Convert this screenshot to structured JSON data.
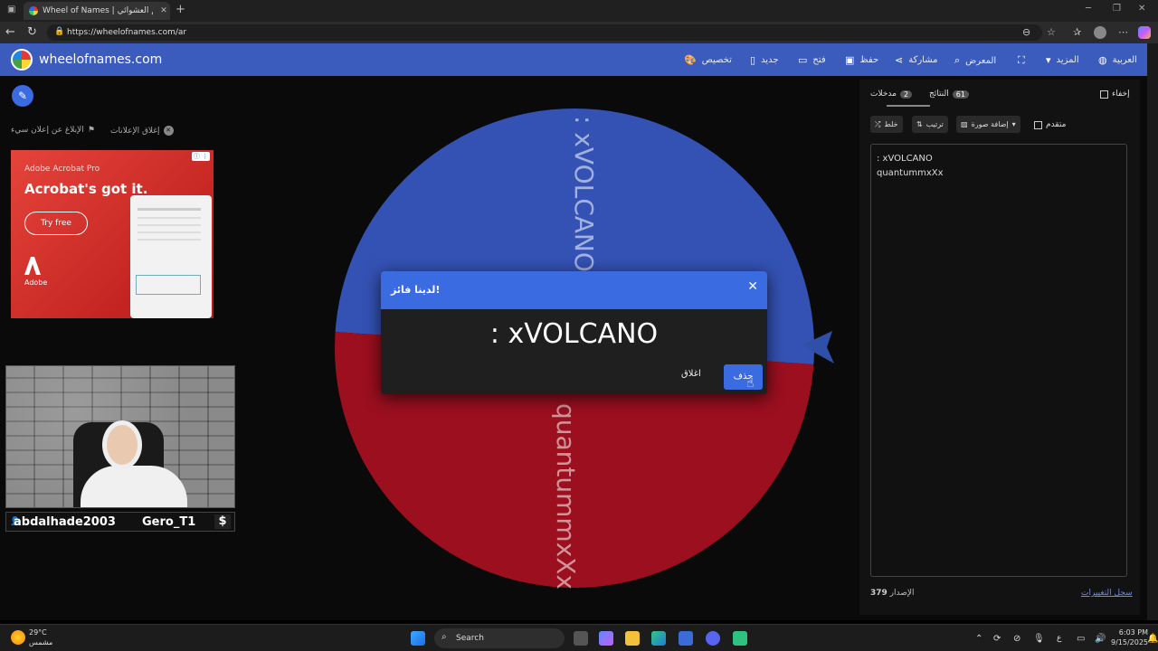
{
  "browser": {
    "tab_title": "Wheel of Names | الاسم العشوائي",
    "url": "https://wheelofnames.com/ar",
    "new_tab": "+",
    "tab_close": "✕"
  },
  "header": {
    "brand": "wheelofnames.com",
    "items": [
      {
        "label": "تخصيص",
        "icon": "palette-icon"
      },
      {
        "label": "جديد",
        "icon": "new-file-icon"
      },
      {
        "label": "فتح",
        "icon": "folder-icon"
      },
      {
        "label": "حفظ",
        "icon": "save-icon"
      },
      {
        "label": "مشاركة",
        "icon": "share-icon"
      },
      {
        "label": "المعرض",
        "icon": "search-icon"
      },
      {
        "label": "",
        "icon": "fullscreen-icon"
      },
      {
        "label": "المزيد",
        "icon": "caret-down-icon"
      },
      {
        "label": "العربية",
        "icon": "globe-icon"
      }
    ]
  },
  "ads": {
    "close_label": "إغلاق الإعلانات",
    "report_label": "الإبلاغ عن إعلان سيء",
    "brand": "Adobe Acrobat Pro",
    "headline": "Acrobat's got it.",
    "cta": "Try free",
    "logo_text": "Adobe"
  },
  "stream": {
    "name1": "abdalhade2003",
    "name2": "Gero_T1",
    "dollar": "$"
  },
  "wheel": {
    "segments": [
      {
        "label": ": xVOLCANO",
        "color": "#3452b4"
      },
      {
        "label": "quantummxXx",
        "color": "#9b0f1f"
      }
    ]
  },
  "dialog": {
    "title": "لدينا فائز!",
    "winner": ": xVOLCANO",
    "close_button": "اغلاق",
    "remove_button": "حذف",
    "close_x": "✕"
  },
  "panel": {
    "tab_entries": "مدخلات",
    "tab_entries_count": "2",
    "tab_results": "النتائج",
    "tab_results_count": "61",
    "hide_label": "إخفاء",
    "shuffle": "خلط",
    "sort": "ترتيب",
    "add_image": "إضافة صورة",
    "advanced": "متقدم",
    "entries": [
      ": xVOLCANO",
      "quantummxXx"
    ],
    "version_label": "الإصدار",
    "version": "379",
    "changelog": "سجل التغييرات"
  },
  "taskbar": {
    "weather_temp": "29°C",
    "weather_desc": "مشمس",
    "search": "Search",
    "lang": "ع",
    "time": "6:03 PM",
    "date": "9/15/2025"
  }
}
